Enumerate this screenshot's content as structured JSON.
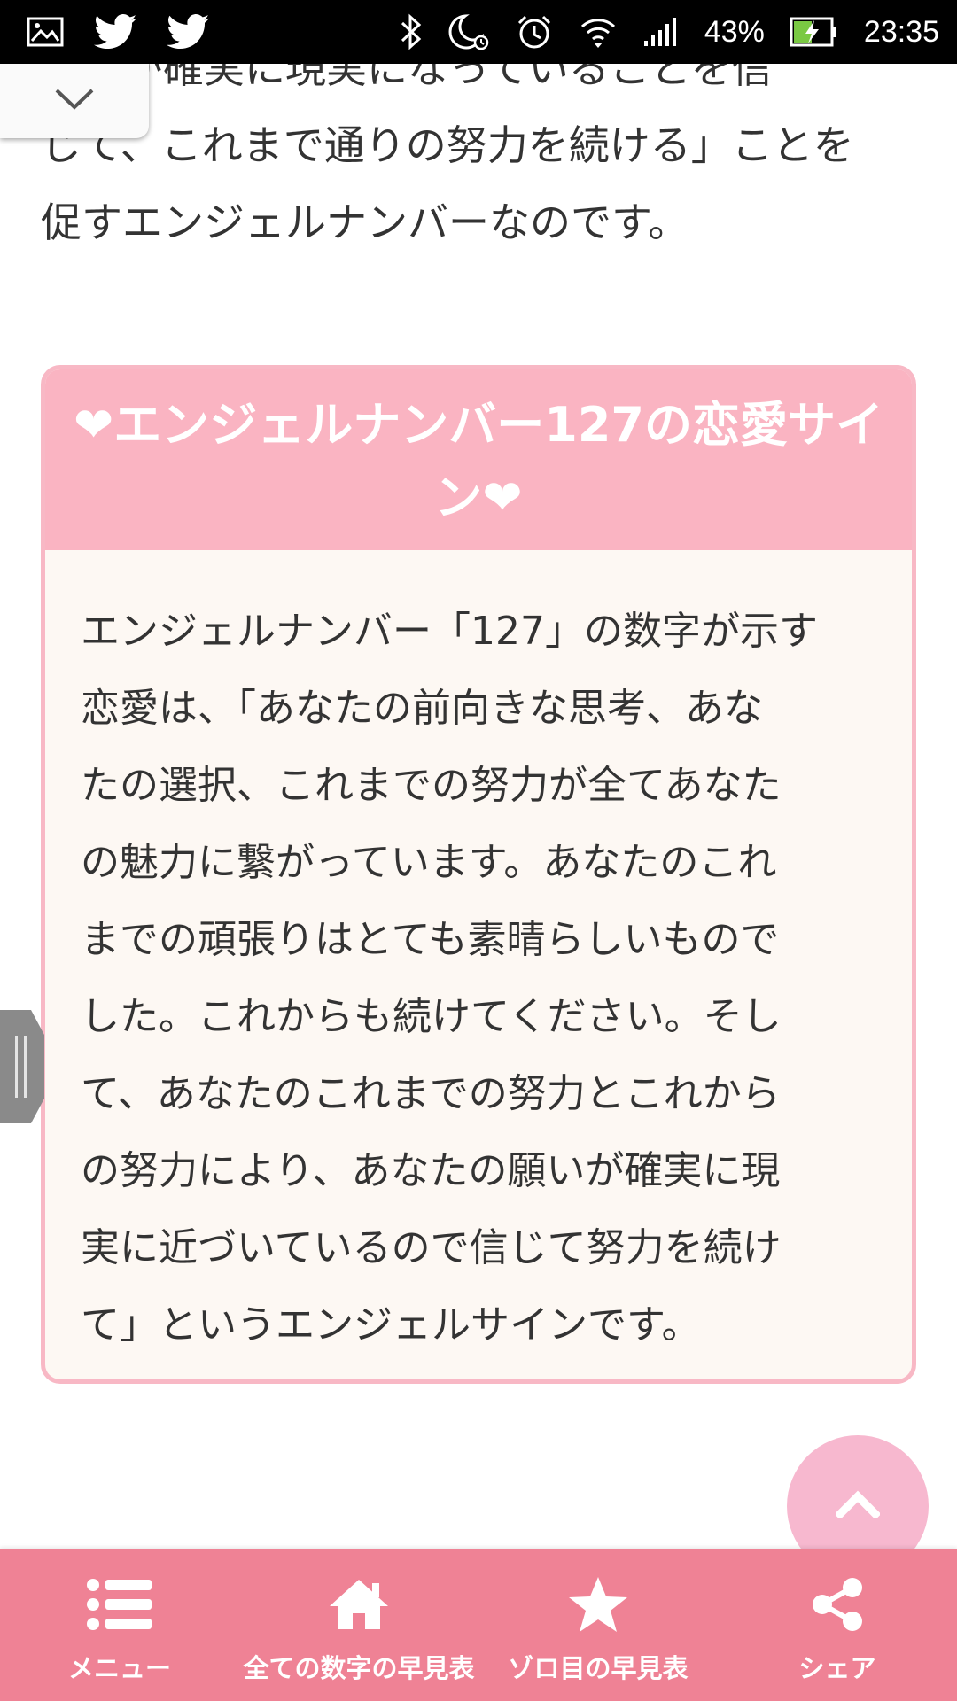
{
  "status_bar": {
    "battery_percent": "43%",
    "time": "23:35",
    "icons": [
      "image-icon",
      "twitter-icon",
      "twitter-icon",
      "bluetooth-icon",
      "night-mode-icon",
      "alarm-icon",
      "wifi-icon",
      "signal-icon",
      "battery-charging-icon"
    ]
  },
  "intro": {
    "line1": "願いが確実に現実になっていることを信",
    "line2": "じて、これまで通りの努力を続ける」ことを",
    "line3": "促すエンジェルナンバーなのです。"
  },
  "love_section": {
    "heading_line1": "❤エンジェルナンバー127の恋愛サイ",
    "heading_line2": "ン❤",
    "body_lines": [
      "エンジェルナンバー「127」の数字が示す",
      "恋愛は、「あなたの前向きな思考、あな",
      "たの選択、これまでの努力が全てあなた",
      "の魅力に繋がっています。あなたのこれ",
      "までの頑張りはとても素晴らしいもので",
      "した。これからも続けてください。そし",
      "て、あなたのこれまでの努力とこれから",
      "の努力により、あなたの願いが確実に現",
      "実に近づいているので信じて努力を続け",
      "て」というエンジェルサインです。"
    ]
  },
  "bottom_nav": {
    "items": [
      {
        "label": "メニュー",
        "icon": "menu-list-icon"
      },
      {
        "label": "全ての数字の早見表",
        "icon": "home-icon"
      },
      {
        "label": "ゾロ目の早見表",
        "icon": "star-icon"
      },
      {
        "label": "シェア",
        "icon": "share-icon"
      }
    ]
  },
  "colors": {
    "accent_pink": "#ef8295",
    "header_pink": "#fab4c2",
    "box_border": "#f8b8c5",
    "box_background": "#fdf8f3",
    "top_button": "#f7b8cf"
  }
}
